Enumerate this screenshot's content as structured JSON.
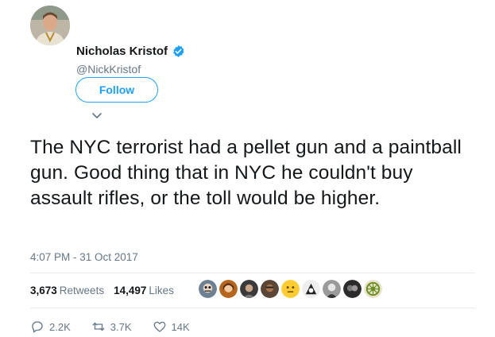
{
  "author": {
    "name": "Nicholas Kristof",
    "handle": "@NickKristof",
    "verified": true,
    "avatar_icon": "profile-photo"
  },
  "follow_label": "Follow",
  "tweet": {
    "text": "The NYC terrorist had a pellet gun and a paintball gun. Good thing that in NYC he couldn't buy assault rifles, or the toll would be higher.",
    "timestamp": "4:07 PM - 31 Oct 2017"
  },
  "stats": {
    "retweets_count": "3,673",
    "retweets_label": "Retweets",
    "likes_count": "14,497",
    "likes_label": "Likes"
  },
  "actions": {
    "replies": "2.2K",
    "retweets": "3.7K",
    "likes": "14K"
  },
  "colors": {
    "accent": "#1da1f2",
    "muted": "#657786",
    "text": "#14171a",
    "divider": "#e6ecf0"
  }
}
